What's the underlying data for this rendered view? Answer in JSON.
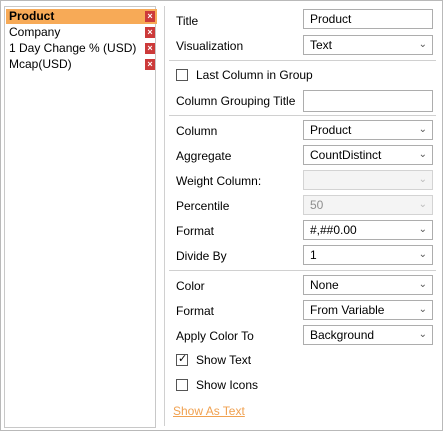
{
  "columns_list": [
    {
      "label": "Product",
      "selected": true
    },
    {
      "label": "Company",
      "selected": false
    },
    {
      "label": "1 Day Change % (USD)",
      "selected": false
    },
    {
      "label": "Mcap(USD)",
      "selected": false
    }
  ],
  "remove_glyph": "×",
  "form": {
    "title_label": "Title",
    "title_value": "Product",
    "visualization_label": "Visualization",
    "visualization_value": "Text",
    "last_column_label": "Last Column in Group",
    "grouping_title_label": "Column Grouping Title",
    "grouping_title_value": "",
    "column_label": "Column",
    "column_value": "Product",
    "aggregate_label": "Aggregate",
    "aggregate_value": "CountDistinct",
    "weight_label": "Weight Column:",
    "weight_value": "",
    "percentile_label": "Percentile",
    "percentile_value": "50",
    "format_label": "Format",
    "format_value": "#,##0.00",
    "divide_label": "Divide By",
    "divide_value": "1",
    "color_label": "Color",
    "color_value": "None",
    "color_format_label": "Format",
    "color_format_value": "From Variable",
    "apply_color_label": "Apply Color To",
    "apply_color_value": "Background",
    "show_text_label": "Show Text",
    "show_icons_label": "Show Icons",
    "show_as_text_link": "Show As Text"
  },
  "checkbox_states": {
    "last_column": false,
    "show_text": true,
    "show_icons": false
  },
  "colors": {
    "selected_item_bg": "#f7aa57",
    "remove_button_bg": "#cc3a3a",
    "link_color": "#f0a150"
  }
}
